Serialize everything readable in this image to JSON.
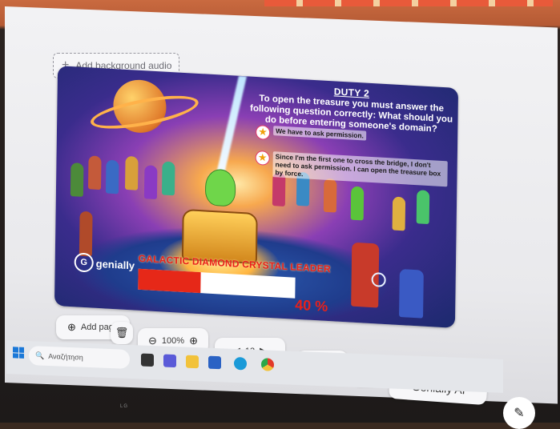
{
  "editor": {
    "add_background_audio": "Add background audio",
    "add_page": "Add page",
    "zoom": "100%",
    "page_number": "13",
    "genially_ai": "Genially AI"
  },
  "slide": {
    "duty_title": "DUTY 2",
    "question": "To open the treasure you must answer the following question correctly: What should you do before entering someone's domain?",
    "answers": [
      {
        "text": "We have to ask permission."
      },
      {
        "text": "Since I'm the first one to cross the bridge, I don't need to ask permission. I can open the treasure box by force."
      }
    ],
    "logo_text": "genially",
    "leader_label": "GALACTIC DIAMOND CRYSTAL LEADER",
    "progress": 40,
    "progress_text": "40 %"
  },
  "taskbar": {
    "search_text": "Αναζήτηση"
  },
  "monitor": {
    "brand": "LG"
  },
  "colors": {
    "progress_fill": "#e62818",
    "leader_text": "#e8201a",
    "answer_border": "#e23a6a"
  }
}
